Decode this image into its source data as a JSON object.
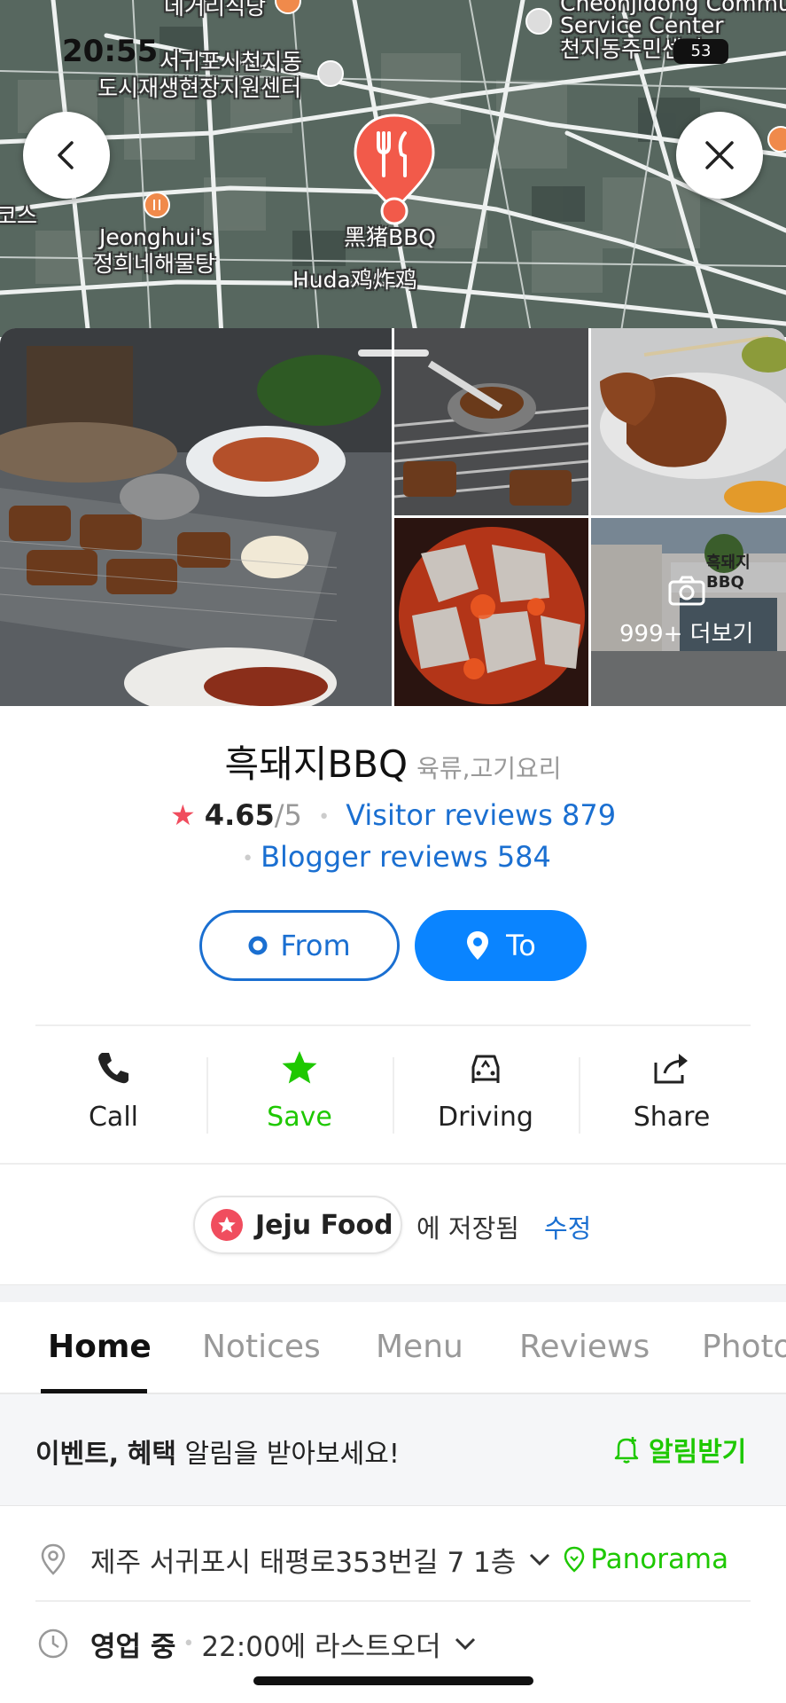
{
  "status_bar": {
    "time": "20:55",
    "battery": "53"
  },
  "map": {
    "labels": {
      "top_restaurant": "데거리식당",
      "service_center_1": "Cheonjidong Commu",
      "service_center_2": "Service Center",
      "service_center_3": "천지동주민센터",
      "urban_center_1": "서귀포시천지동",
      "urban_center_2": "도시재생현장지원센터",
      "jeonghui_1": "Jeonghui's",
      "jeonghui_2": "정희네해물탕",
      "selected_place": "黑猪BBQ",
      "huda": "Huda鸡炸鸡",
      "left_edge": "코스"
    }
  },
  "photos": {
    "more_label": "999+ 더보기",
    "storefront_sign": "흑돼지 BBQ"
  },
  "place": {
    "name": "흑돼지BBQ",
    "category": "육류,고기요리",
    "rating": "4.65",
    "rating_max": "/5",
    "visitor_reviews": "Visitor reviews 879",
    "blogger_reviews": "Blogger reviews 584"
  },
  "route": {
    "from": "From",
    "to": "To"
  },
  "actions": {
    "call": "Call",
    "save": "Save",
    "driving": "Driving",
    "share": "Share"
  },
  "saved": {
    "list_name": "Jeju Food",
    "saved_text": "에 저장됨",
    "edit": "수정"
  },
  "tabs": [
    "Home",
    "Notices",
    "Menu",
    "Reviews",
    "Photo"
  ],
  "event": {
    "bold1": "이벤트,",
    "bold2": "혜택",
    "rest": " 알림을 받아보세요!",
    "alarm": "알림받기"
  },
  "address": {
    "text": "제주 서귀포시 태평로353번길 7 1층",
    "panorama": "Panorama"
  },
  "hours": {
    "status": "영업 중",
    "detail": "22:00에 라스트오더"
  },
  "colors": {
    "accent_blue": "#0a84ff",
    "link_blue": "#1a6fd1",
    "save_green": "#1ec800",
    "star_red": "#f04d5e",
    "pin_red": "#f25a4a"
  }
}
